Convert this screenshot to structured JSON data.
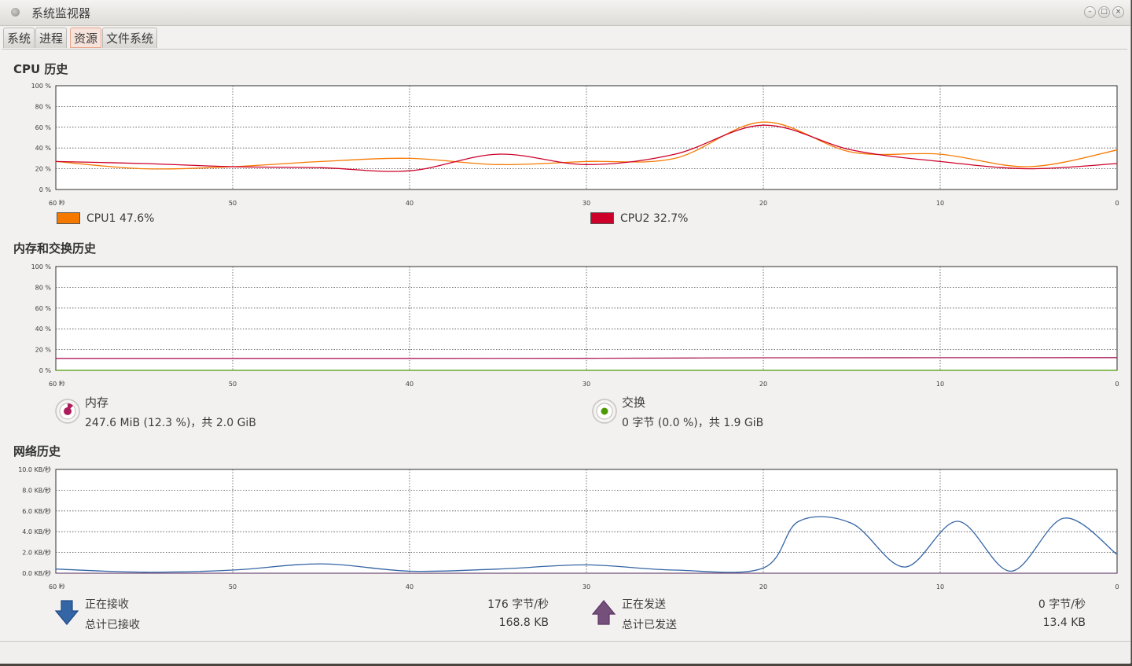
{
  "window": {
    "title": "系统监视器"
  },
  "tabs": [
    {
      "label": "系统",
      "active": false
    },
    {
      "label": "进程",
      "active": false
    },
    {
      "label": "资源",
      "active": true
    },
    {
      "label": "文件系统",
      "active": false
    }
  ],
  "cpu": {
    "title": "CPU 历史",
    "legend": [
      {
        "name": "CPU1",
        "value": "47.6%",
        "color": "#f57900"
      },
      {
        "name": "CPU2",
        "value": "32.7%",
        "color": "#cc0029"
      }
    ]
  },
  "memory": {
    "title": "内存和交换历史",
    "memory": {
      "label": "内存",
      "value": "247.6 MiB (12.3 %)，共 2.0 GiB",
      "color": "#ad1d5b"
    },
    "swap": {
      "label": "交换",
      "value": "0 字节 (0.0 %)，共 1.9 GiB",
      "color": "#4e9a06"
    }
  },
  "network": {
    "title": "网络历史",
    "receiving": {
      "label": "正在接收",
      "value": "176 字节/秒",
      "total_label": "总计已接收",
      "total_value": "168.8 KB",
      "color": "#3465a4"
    },
    "sending": {
      "label": "正在发送",
      "value": "0 字节/秒",
      "total_label": "总计已发送",
      "total_value": "13.4 KB",
      "color": "#75507b"
    }
  },
  "chart_data": [
    {
      "type": "line",
      "title": "CPU 历史",
      "x": [
        60,
        55,
        50,
        45,
        40,
        35,
        30,
        25,
        20,
        15,
        10,
        5,
        0
      ],
      "xlim": [
        60,
        0
      ],
      "x_tick_labels": [
        "60 秒",
        "50",
        "40",
        "30",
        "20",
        "10",
        "0"
      ],
      "ylim": [
        0,
        100
      ],
      "y_tick_labels": [
        "100 %",
        "80 %",
        "60 %",
        "40 %",
        "20 %",
        "0 %"
      ],
      "grid": true,
      "series": [
        {
          "name": "CPU1",
          "color": "#f57900",
          "values": [
            27,
            20,
            22,
            27,
            30,
            24,
            27,
            30,
            65,
            36,
            34,
            22,
            38
          ]
        },
        {
          "name": "CPU2",
          "color": "#cc0029",
          "values": [
            27,
            25,
            22,
            21,
            18,
            34,
            24,
            34,
            62,
            38,
            27,
            20,
            25
          ]
        }
      ]
    },
    {
      "type": "line",
      "title": "内存和交换历史",
      "x": [
        60,
        50,
        40,
        30,
        20,
        10,
        0
      ],
      "xlim": [
        60,
        0
      ],
      "x_tick_labels": [
        "60 秒",
        "50",
        "40",
        "30",
        "20",
        "10",
        "0"
      ],
      "ylim": [
        0,
        100
      ],
      "y_tick_labels": [
        "100 %",
        "80 %",
        "60 %",
        "40 %",
        "20 %",
        "0 %"
      ],
      "grid": true,
      "series": [
        {
          "name": "内存",
          "color": "#ad1d5b",
          "values": [
            11.5,
            11.5,
            11.5,
            11.6,
            12.1,
            12.2,
            12.3
          ]
        },
        {
          "name": "交换",
          "color": "#4e9a06",
          "values": [
            0,
            0,
            0,
            0,
            0,
            0,
            0
          ]
        }
      ]
    },
    {
      "type": "line",
      "title": "网络历史",
      "x": [
        60,
        55,
        50,
        45,
        40,
        35,
        30,
        25,
        20,
        18,
        15,
        12,
        9,
        6,
        3,
        0
      ],
      "xlim": [
        60,
        0
      ],
      "x_tick_labels": [
        "60 秒",
        "50",
        "40",
        "30",
        "20",
        "10",
        "0"
      ],
      "ylim": [
        0,
        10
      ],
      "y_tick_labels": [
        "10.0 KB/秒",
        "8.0 KB/秒",
        "6.0 KB/秒",
        "4.0 KB/秒",
        "2.0 KB/秒",
        "0.0 KB/秒"
      ],
      "grid": true,
      "series": [
        {
          "name": "正在接收",
          "color": "#3465a4",
          "values": [
            0.4,
            0.1,
            0.3,
            0.9,
            0.2,
            0.4,
            0.8,
            0.3,
            0.5,
            5.0,
            4.8,
            0.6,
            5.0,
            0.2,
            5.3,
            1.8
          ]
        },
        {
          "name": "正在发送",
          "color": "#75507b",
          "values": [
            0,
            0,
            0,
            0,
            0,
            0,
            0,
            0,
            0,
            0,
            0,
            0,
            0,
            0,
            0,
            0
          ]
        }
      ]
    }
  ]
}
